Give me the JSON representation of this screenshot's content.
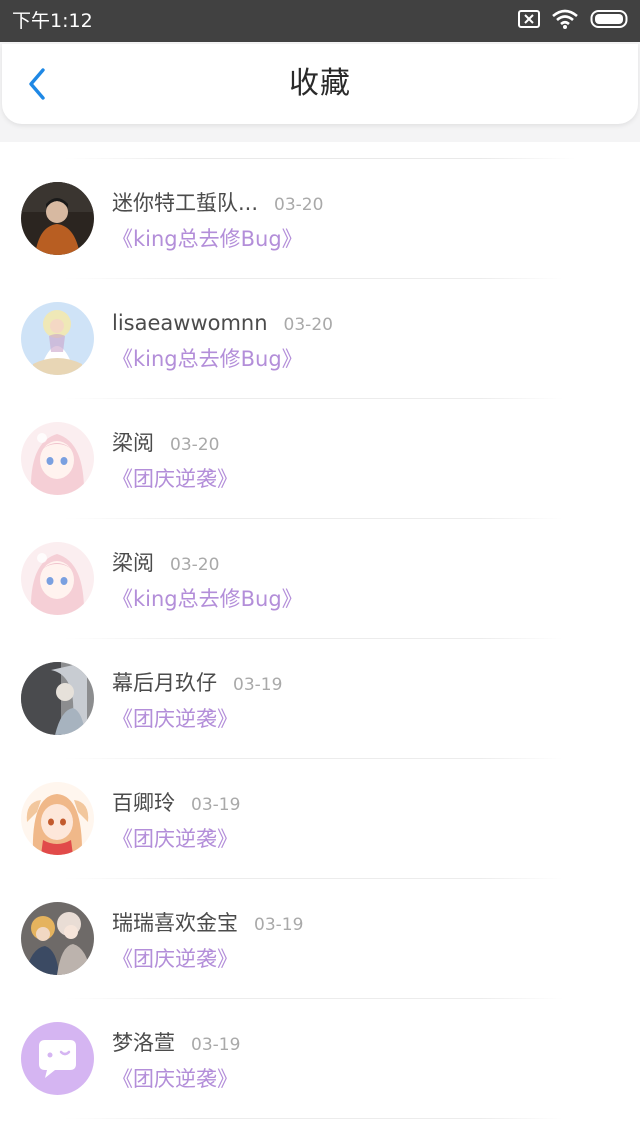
{
  "status_bar": {
    "time": "下午1:12",
    "icons": [
      "sim-off-icon",
      "wifi-icon",
      "battery-icon"
    ]
  },
  "header": {
    "title": "收藏",
    "back_icon": "chevron-left-icon",
    "accent_color": "#1e88e5"
  },
  "colors": {
    "title_link": "#b38ed9",
    "name": "#4b4b4b",
    "date": "#a9a9a9",
    "default_avatar": "#d5b5f2"
  },
  "favorites": [
    {
      "name": "迷你特工蜇队...",
      "date": "03-20",
      "title": "《king总去修Bug》",
      "avatar": "photo-dark"
    },
    {
      "name": "lisaeawwomnn",
      "date": "03-20",
      "title": "《king总去修Bug》",
      "avatar": "goddess-blue"
    },
    {
      "name": "梁阅",
      "date": "03-20",
      "title": "《团庆逆袭》",
      "avatar": "anime-pink"
    },
    {
      "name": "梁阅",
      "date": "03-20",
      "title": "《king总去修Bug》",
      "avatar": "anime-pink"
    },
    {
      "name": "幕后月玖仔",
      "date": "03-19",
      "title": "《团庆逆袭》",
      "avatar": "grey-art"
    },
    {
      "name": "百卿玲",
      "date": "03-19",
      "title": "《团庆逆袭》",
      "avatar": "anime-lamb"
    },
    {
      "name": "瑞瑞喜欢金宝",
      "date": "03-19",
      "title": "《团庆逆袭》",
      "avatar": "anime-group"
    },
    {
      "name": "梦洛萱",
      "date": "03-19",
      "title": "《团庆逆袭》",
      "avatar": "default-chat"
    }
  ]
}
